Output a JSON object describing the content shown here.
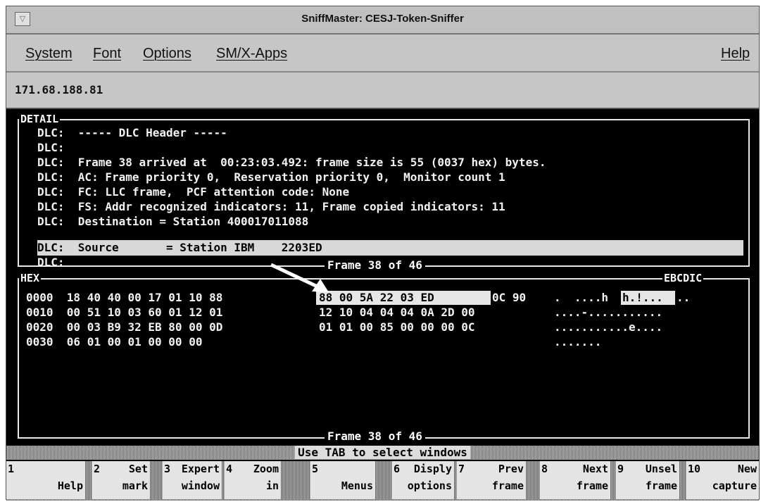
{
  "window": {
    "title": "SniffMaster: CESJ-Token-Sniffer"
  },
  "menu": {
    "items": [
      "System",
      "Font",
      "Options",
      "SM/X-Apps"
    ],
    "help": "Help"
  },
  "address": "171.68.188.81",
  "detail": {
    "label": "DETAIL",
    "lines": [
      {
        "prefix": "DLC:",
        "text": "----- DLC Header -----"
      },
      {
        "prefix": "DLC:",
        "text": ""
      },
      {
        "prefix": "DLC:",
        "text": "Frame 38 arrived at  00:23:03.492: frame size is 55 (0037 hex) bytes."
      },
      {
        "prefix": "DLC:",
        "text": "AC: Frame priority 0,  Reservation priority 0,  Monitor count 1"
      },
      {
        "prefix": "DLC:",
        "text": "FC: LLC frame,  PCF attention code: None"
      },
      {
        "prefix": "DLC:",
        "text": "FS: Addr recognized indicators: 11, Frame copied indicators: 11"
      },
      {
        "prefix": "DLC:",
        "text": "Destination = Station 400017011088"
      },
      {
        "prefix": "DLC:",
        "text": "Source       = Station IBM    2203ED"
      },
      {
        "prefix": "DLC:",
        "text": ""
      }
    ],
    "frame_label": "Frame 38 of 46"
  },
  "hex": {
    "label": "HEX",
    "ebcdic_label": "EBCDIC",
    "rows": [
      {
        "offset": "0000",
        "bytes1": "18 40 40 00 17 01 10 88",
        "bytes2_hl": "88 00 5A 22 03 ED",
        "bytes2_rest": "0C 90",
        "ebcdic_pre": ".  ....h",
        "ebcdic_hl": "h.!...",
        "ebcdic_post": ".."
      },
      {
        "offset": "0010",
        "bytes1": "00 51 10 03 60 01 12 01",
        "bytes2_hl": "",
        "bytes2_rest": "12 10 04 04 04 0A 2D 00",
        "ebcdic_pre": "....-...........",
        "ebcdic_hl": "",
        "ebcdic_post": ""
      },
      {
        "offset": "0020",
        "bytes1": "00 03 B9 32 EB 80 00 0D",
        "bytes2_hl": "",
        "bytes2_rest": "01 01 00 85 00 00 00 0C",
        "ebcdic_pre": "...........e....",
        "ebcdic_hl": "",
        "ebcdic_post": ""
      },
      {
        "offset": "0030",
        "bytes1": "06 01 00 01 00 00 00",
        "bytes2_hl": "",
        "bytes2_rest": "",
        "ebcdic_pre": ".......",
        "ebcdic_hl": "",
        "ebcdic_post": ""
      }
    ],
    "frame_label": "Frame 38 of 46"
  },
  "status": "Use TAB to select windows",
  "fkeys": [
    {
      "num": "1",
      "line1": "",
      "line2": "Help"
    },
    {
      "num": "2",
      "line1": "Set",
      "line2": "mark"
    },
    {
      "num": "3",
      "line1": "Expert",
      "line2": "window"
    },
    {
      "num": "4",
      "line1": "Zoom",
      "line2": "in"
    },
    {
      "num": "5",
      "line1": "",
      "line2": "Menus"
    },
    {
      "num": "6",
      "line1": "Disply",
      "line2": "options"
    },
    {
      "num": "7",
      "line1": "Prev",
      "line2": "frame"
    },
    {
      "num": "8",
      "line1": "Next",
      "line2": "frame"
    },
    {
      "num": "9",
      "line1": "Unsel",
      "line2": "frame"
    },
    {
      "num": "10",
      "line1": "New",
      "line2": "capture"
    }
  ]
}
